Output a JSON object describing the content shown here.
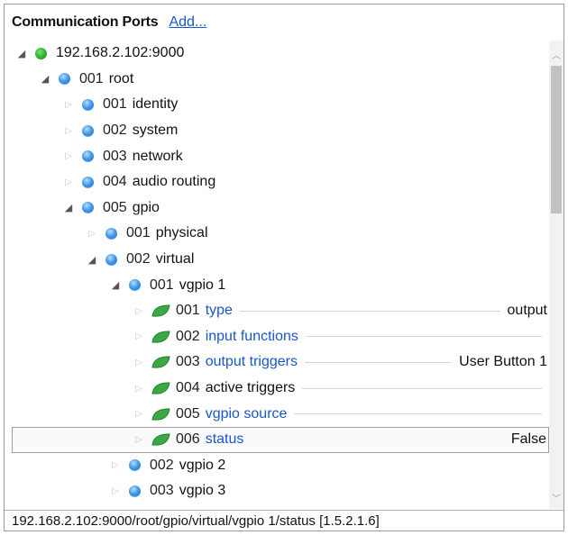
{
  "header": {
    "title": "Communication Ports",
    "add_link": "Add..."
  },
  "tree": {
    "rows": [
      {
        "id": "r0",
        "num": "",
        "label": "192.168.2.102:9000",
        "icon": "green-circle-icon",
        "value": ""
      },
      {
        "id": "r1",
        "num": "001",
        "label": "root",
        "icon": "blue-circle-icon",
        "value": ""
      },
      {
        "id": "r2",
        "num": "001",
        "label": "identity",
        "icon": "blue-circle-icon",
        "value": ""
      },
      {
        "id": "r3",
        "num": "002",
        "label": "system",
        "icon": "blue-circle-icon",
        "value": ""
      },
      {
        "id": "r4",
        "num": "003",
        "label": "network",
        "icon": "blue-circle-icon",
        "value": ""
      },
      {
        "id": "r5",
        "num": "004",
        "label": "audio routing",
        "icon": "blue-circle-icon",
        "value": ""
      },
      {
        "id": "r6",
        "num": "005",
        "label": "gpio",
        "icon": "blue-circle-icon",
        "value": ""
      },
      {
        "id": "r7",
        "num": "001",
        "label": "physical",
        "icon": "blue-circle-icon",
        "value": ""
      },
      {
        "id": "r8",
        "num": "002",
        "label": "virtual",
        "icon": "blue-circle-icon",
        "value": ""
      },
      {
        "id": "r9",
        "num": "001",
        "label": "vgpio 1",
        "icon": "blue-circle-icon",
        "value": ""
      },
      {
        "id": "r10",
        "num": "001",
        "label": "type",
        "icon": "green-leaf-icon",
        "value": "output"
      },
      {
        "id": "r11",
        "num": "002",
        "label": "input functions",
        "icon": "green-leaf-icon",
        "value": ""
      },
      {
        "id": "r12",
        "num": "003",
        "label": "output triggers",
        "icon": "green-leaf-icon",
        "value": "User Button 1"
      },
      {
        "id": "r13",
        "num": "004",
        "label": "active triggers",
        "icon": "green-leaf-icon",
        "value": ""
      },
      {
        "id": "r14",
        "num": "005",
        "label": "vgpio source",
        "icon": "green-leaf-icon",
        "value": ""
      },
      {
        "id": "r15",
        "num": "006",
        "label": "status",
        "icon": "green-leaf-icon",
        "value": "False"
      },
      {
        "id": "r16",
        "num": "002",
        "label": "vgpio 2",
        "icon": "blue-circle-icon",
        "value": ""
      },
      {
        "id": "r17",
        "num": "003",
        "label": "vgpio 3",
        "icon": "blue-circle-icon",
        "value": ""
      }
    ]
  },
  "statusbar": {
    "path": "192.168.2.102:9000/root/gpio/virtual/vgpio 1/status [1.5.2.1.6]"
  },
  "colors": {
    "link": "#1a56c8",
    "node_green": "#2db02d",
    "node_blue": "#3f97e8",
    "leaf_green": "#3aa845"
  }
}
